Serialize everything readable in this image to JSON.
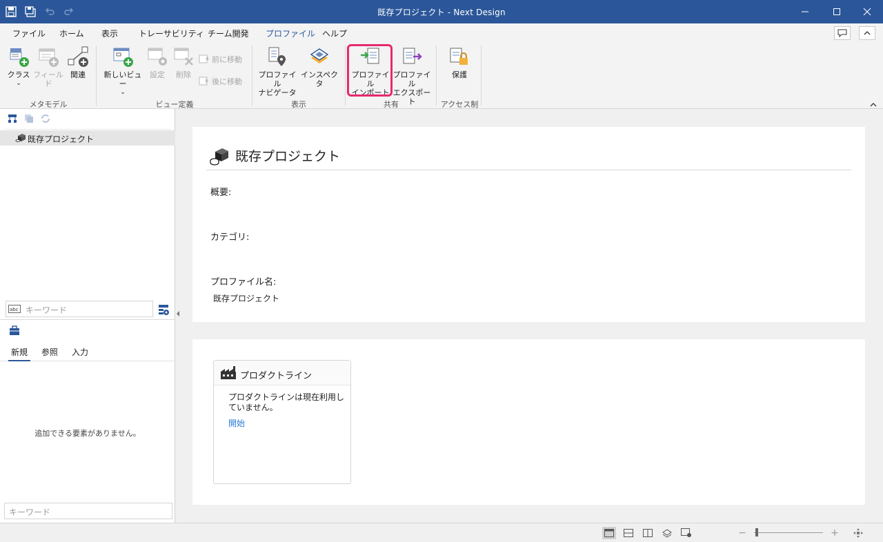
{
  "window": {
    "title": "既存プロジェクト - Next Design"
  },
  "ribbon_tabs": [
    "ファイル",
    "ホーム",
    "表示",
    "トレーサビリティ",
    "チーム開発",
    "プロファイル",
    "ヘルプ"
  ],
  "active_tab": "プロファイル",
  "ribbon": {
    "metamodel": {
      "class_label": "クラス",
      "field_label": "フィールド",
      "relation_label": "関連",
      "group_label": "メタモデル"
    },
    "view_def": {
      "new_view_label": "新しいビュー",
      "settings_label": "設定",
      "delete_label": "削除",
      "move_forward_label": "前に移動",
      "move_back_label": "後に移動",
      "group_label": "ビュー定義"
    },
    "display": {
      "navigator_line1": "プロファイル",
      "navigator_line2": "ナビゲータ",
      "inspector_label": "インスペクタ",
      "group_label": "表示"
    },
    "share": {
      "import_line1": "プロファイル",
      "import_line2": "インポート",
      "export_line1": "プロファイル",
      "export_line2": "エクスポート",
      "group_label": "共有"
    },
    "access": {
      "protect_label": "保護",
      "group_label": "アクセス制御"
    }
  },
  "tree": {
    "root_label": "既存プロジェクト",
    "search_placeholder": "キーワード"
  },
  "palette": {
    "tabs": [
      "新規",
      "参照",
      "入力"
    ],
    "active_tab": "新規",
    "empty_message": "追加できる要素がありません。",
    "search_placeholder": "キーワード"
  },
  "project": {
    "title": "既存プロジェクト",
    "overview_label": "概要:",
    "category_label": "カテゴリ:",
    "profile_name_label": "プロファイル名:",
    "profile_name_value": "既存プロジェクト"
  },
  "productline": {
    "title": "プロダクトライン",
    "message": "プロダクトラインは現在利用していません。",
    "start_link": "開始"
  },
  "colors": {
    "title_bar": "#2b579a",
    "highlight": "#e8286e",
    "link": "#2b7bd6"
  }
}
